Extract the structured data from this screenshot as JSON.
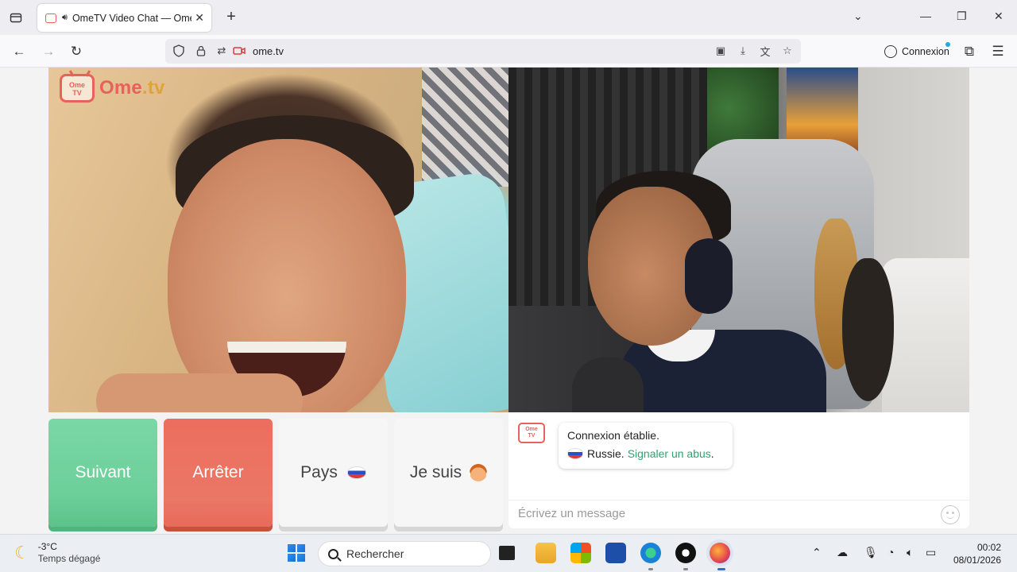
{
  "browser": {
    "tab": {
      "title": "OmeTV Video Chat — Ome"
    },
    "url": "ome.tv",
    "account_button": "Connexion"
  },
  "page": {
    "logo": {
      "badge_line1": "Ome",
      "badge_line2": "TV",
      "brand_main": "Ome",
      "brand_suffix": ".tv"
    },
    "buttons": {
      "next": "Suivant",
      "stop": "Arrêter",
      "country": "Pays",
      "gender": "Je suis"
    },
    "chat": {
      "badge_line1": "Ome",
      "badge_line2": "TV",
      "connection_message": "Connexion établie.",
      "country_name": "Russie.",
      "report_link": "Signaler un abus",
      "report_suffix": ".",
      "input_placeholder": "Écrivez un message"
    }
  },
  "taskbar": {
    "weather": {
      "temp": "-3°C",
      "condition": "Temps dégagé"
    },
    "search_label": "Rechercher",
    "clock": {
      "time": "00:02",
      "date": "08/01/2026"
    }
  },
  "colors": {
    "brand": "#e8615b",
    "next_button": "#6ccf9a",
    "stop_button": "#eb7767",
    "report_link": "#2ea36f"
  }
}
